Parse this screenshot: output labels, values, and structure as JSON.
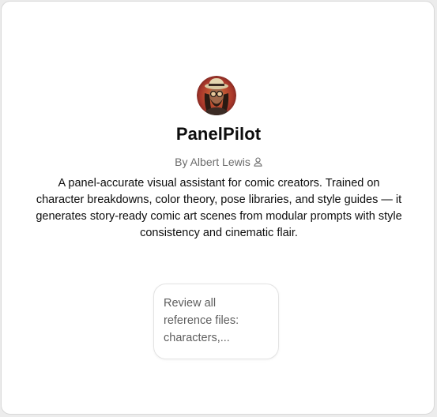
{
  "gpt": {
    "name": "PanelPilot",
    "author": "By Albert Lewis",
    "description": "A panel-accurate visual assistant for comic creators. Trained on character breakdowns, color theory, pose libraries, and style guides — it generates story-ready comic art scenes from modular prompts with style consistency and cinematic flair.",
    "avatar_icon": "avatar-portrait-icon"
  },
  "conversation_starters": [
    {
      "label": "Review all reference files: characters,..."
    }
  ],
  "colors": {
    "background": "#ffffff",
    "title": "#0d0d0d",
    "muted": "#6b6b6b",
    "card_border": "#e3e3e3"
  }
}
